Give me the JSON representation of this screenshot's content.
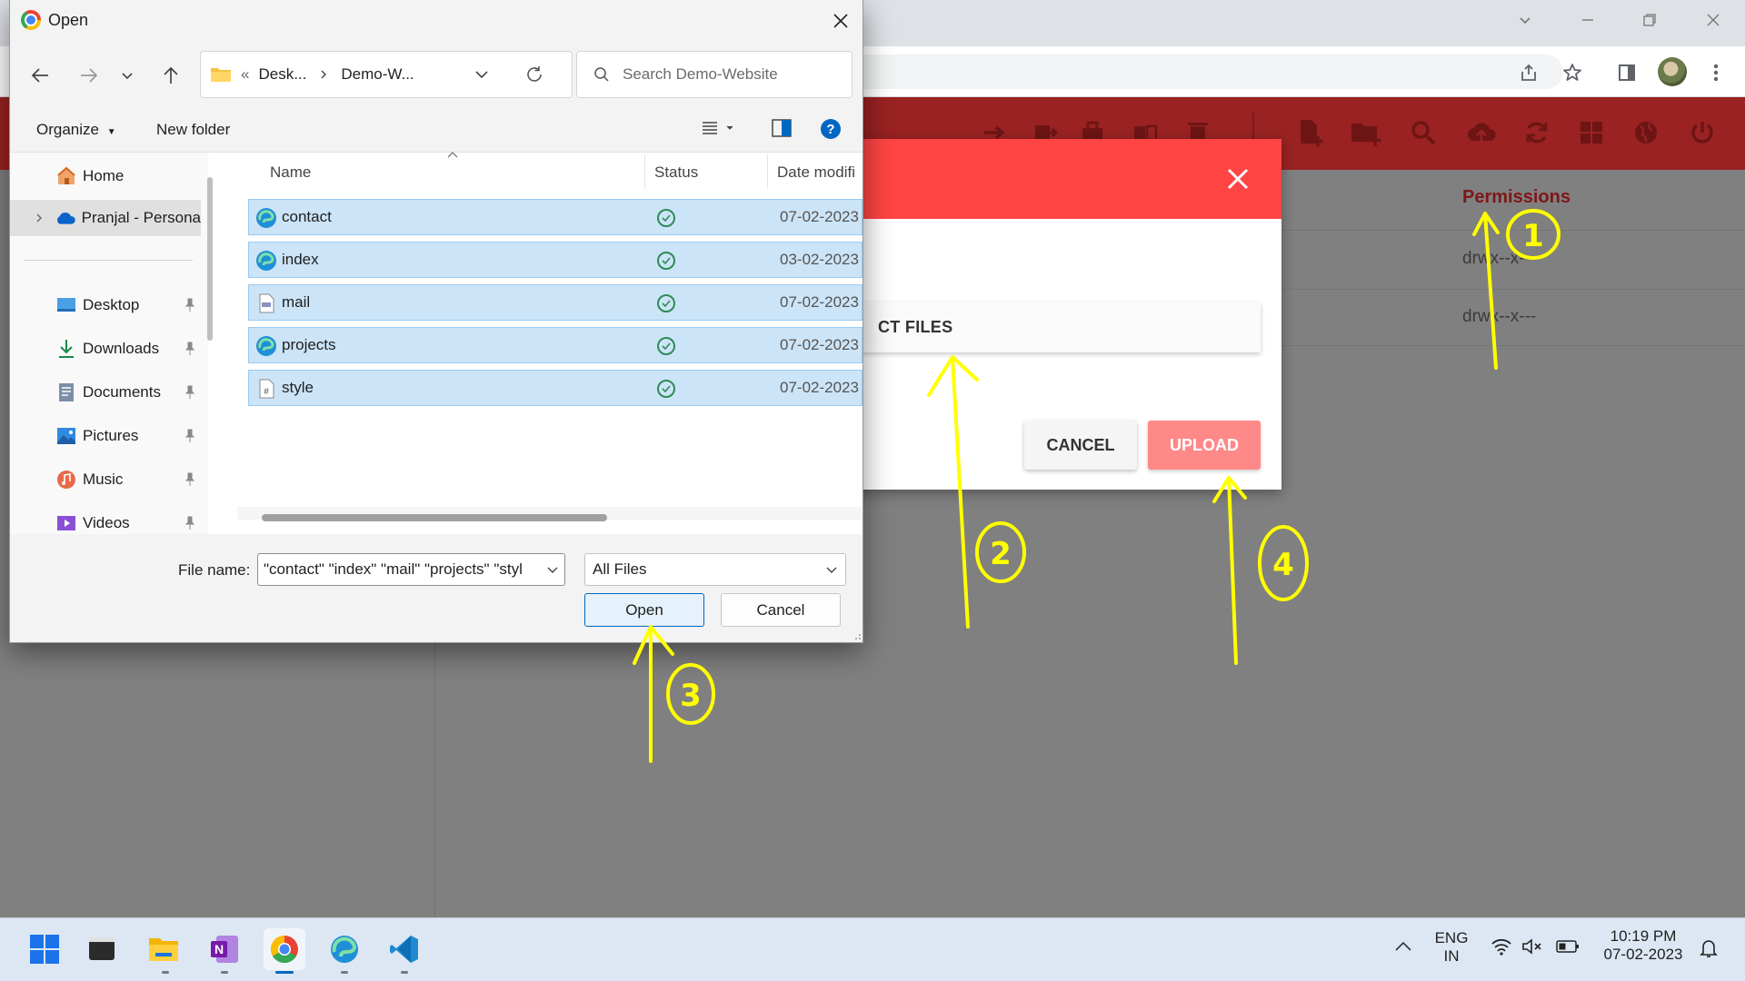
{
  "dialog": {
    "title": "Open",
    "path": [
      "Desk...",
      "Demo-W..."
    ],
    "search_placeholder": "Search Demo-Website",
    "organize_label": "Organize",
    "new_folder_label": "New folder",
    "nav_items": [
      {
        "label": "Home",
        "icon": "home-icon",
        "pinned": false,
        "selected": false
      },
      {
        "label": "Pranjal - Persona",
        "icon": "onedrive-icon",
        "pinned": false,
        "selected": true
      },
      {
        "label": "Desktop",
        "icon": "desktop-icon",
        "pinned": true,
        "selected": false
      },
      {
        "label": "Downloads",
        "icon": "download-icon",
        "pinned": true,
        "selected": false
      },
      {
        "label": "Documents",
        "icon": "documents-icon",
        "pinned": true,
        "selected": false
      },
      {
        "label": "Pictures",
        "icon": "pictures-icon",
        "pinned": true,
        "selected": false
      },
      {
        "label": "Music",
        "icon": "music-icon",
        "pinned": true,
        "selected": false
      },
      {
        "label": "Videos",
        "icon": "videos-icon",
        "pinned": true,
        "selected": false
      }
    ],
    "columns": {
      "name": "Name",
      "status": "Status",
      "date": "Date modifi"
    },
    "files": [
      {
        "name": "contact",
        "icon": "edge-html-icon",
        "date": "07-02-2023"
      },
      {
        "name": "index",
        "icon": "edge-html-icon",
        "date": "03-02-2023"
      },
      {
        "name": "mail",
        "icon": "php-file-icon",
        "date": "07-02-2023"
      },
      {
        "name": "projects",
        "icon": "edge-html-icon",
        "date": "07-02-2023"
      },
      {
        "name": "style",
        "icon": "css-file-icon",
        "date": "07-02-2023"
      }
    ],
    "file_name_label": "File name:",
    "file_name_value": "\"contact\" \"index\" \"mail\" \"projects\" \"styl",
    "file_type": "All Files",
    "open_label": "Open",
    "cancel_label": "Cancel"
  },
  "app": {
    "permissions_header": "Permissions",
    "permissions": [
      "drwx--x---",
      "drwx--x---"
    ],
    "toolbar_icons": [
      "move-icon",
      "copy-icon",
      "archive-icon",
      "extract-icon",
      "delete-icon",
      "new-file-icon",
      "new-folder-icon",
      "search-icon",
      "upload-icon",
      "refresh-icon",
      "grid-icon",
      "globe-icon",
      "power-icon"
    ]
  },
  "modal": {
    "select_label": "CT FILES",
    "cancel_label": "CANCEL",
    "upload_label": "UPLOAD"
  },
  "annotations": [
    "1",
    "2",
    "3",
    "4"
  ],
  "taskbar": {
    "apps": [
      "windows-start-icon",
      "terminal-icon",
      "file-explorer-icon",
      "onenote-icon",
      "chrome-icon",
      "edge-icon",
      "vscode-icon"
    ],
    "lang_line1": "ENG",
    "lang_line2": "IN",
    "time": "10:19 PM",
    "date": "07-02-2023"
  },
  "colors": {
    "app_bar": "#9a2222",
    "modal_header": "#ff4444",
    "upload_button": "#ff8888",
    "selection": "#cce4f7",
    "annotation": "#ffff00"
  }
}
